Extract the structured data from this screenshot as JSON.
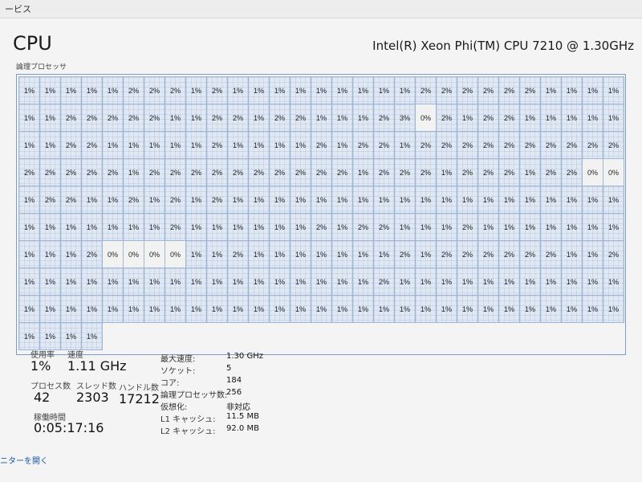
{
  "topbar": {
    "text": "ービス"
  },
  "header": {
    "title": "CPU",
    "cpu_model": "Intel(R) Xeon Phi(TM) CPU 7210 @ 1.30GHz",
    "grid_label": "論理プロセッサ"
  },
  "processors": [
    "1%",
    "1%",
    "1%",
    "1%",
    "1%",
    "2%",
    "2%",
    "2%",
    "1%",
    "2%",
    "1%",
    "1%",
    "1%",
    "1%",
    "1%",
    "1%",
    "1%",
    "1%",
    "1%",
    "2%",
    "2%",
    "2%",
    "2%",
    "2%",
    "2%",
    "1%",
    "1%",
    "1%",
    "1%",
    "1%",
    "1%",
    "2%",
    "2%",
    "2%",
    "2%",
    "2%",
    "1%",
    "1%",
    "2%",
    "2%",
    "1%",
    "2%",
    "2%",
    "1%",
    "1%",
    "1%",
    "2%",
    "3%",
    "0%",
    "2%",
    "1%",
    "2%",
    "2%",
    "1%",
    "1%",
    "1%",
    "1%",
    "1%",
    "1%",
    "1%",
    "2%",
    "2%",
    "1%",
    "1%",
    "1%",
    "1%",
    "1%",
    "2%",
    "1%",
    "1%",
    "1%",
    "1%",
    "2%",
    "1%",
    "2%",
    "2%",
    "1%",
    "2%",
    "2%",
    "2%",
    "2%",
    "2%",
    "2%",
    "2%",
    "2%",
    "2%",
    "2%",
    "2%",
    "2%",
    "2%",
    "2%",
    "2%",
    "1%",
    "2%",
    "2%",
    "2%",
    "2%",
    "2%",
    "2%",
    "2%",
    "2%",
    "2%",
    "2%",
    "1%",
    "2%",
    "2%",
    "2%",
    "1%",
    "2%",
    "2%",
    "2%",
    "1%",
    "2%",
    "2%",
    "0%",
    "0%",
    "1%",
    "2%",
    "2%",
    "1%",
    "1%",
    "2%",
    "1%",
    "2%",
    "1%",
    "2%",
    "1%",
    "1%",
    "1%",
    "1%",
    "1%",
    "1%",
    "1%",
    "1%",
    "1%",
    "1%",
    "1%",
    "1%",
    "1%",
    "1%",
    "1%",
    "1%",
    "1%",
    "1%",
    "1%",
    "1%",
    "1%",
    "1%",
    "1%",
    "1%",
    "1%",
    "1%",
    "2%",
    "1%",
    "1%",
    "1%",
    "1%",
    "1%",
    "1%",
    "2%",
    "1%",
    "2%",
    "2%",
    "1%",
    "1%",
    "1%",
    "2%",
    "1%",
    "1%",
    "1%",
    "1%",
    "1%",
    "1%",
    "1%",
    "1%",
    "1%",
    "1%",
    "2%",
    "0%",
    "0%",
    "0%",
    "0%",
    "1%",
    "1%",
    "2%",
    "1%",
    "1%",
    "1%",
    "1%",
    "1%",
    "1%",
    "1%",
    "2%",
    "1%",
    "2%",
    "2%",
    "2%",
    "2%",
    "2%",
    "2%",
    "1%",
    "1%",
    "2%",
    "1%",
    "1%",
    "1%",
    "1%",
    "1%",
    "1%",
    "1%",
    "1%",
    "1%",
    "1%",
    "1%",
    "1%",
    "1%",
    "1%",
    "1%",
    "1%",
    "1%",
    "2%",
    "1%",
    "1%",
    "1%",
    "1%",
    "1%",
    "1%",
    "1%",
    "1%",
    "1%",
    "1%",
    "1%",
    "1%",
    "1%",
    "1%",
    "1%",
    "1%",
    "1%",
    "1%",
    "1%",
    "1%",
    "1%",
    "1%",
    "1%",
    "1%",
    "1%",
    "1%",
    "1%",
    "1%",
    "1%",
    "1%",
    "1%",
    "1%",
    "1%",
    "1%",
    "1%",
    "1%",
    "1%",
    "1%",
    "1%",
    "1%",
    "1%",
    "1%",
    "1%",
    "1%"
  ],
  "stats": {
    "usage_label": "使用率",
    "usage_value": "1%",
    "speed_label": "速度",
    "speed_value": "1.11 GHz",
    "processes_label": "プロセス数",
    "processes_value": "42",
    "threads_label": "スレッド数",
    "threads_value": "2303",
    "handles_label": "ハンドル数",
    "handles_value": "17212",
    "uptime_label": "稼働時間",
    "uptime_value": "0:05:17:16"
  },
  "specs": [
    {
      "label": "最大速度:",
      "value": "1.30 GHz"
    },
    {
      "label": "ソケット:",
      "value": "5"
    },
    {
      "label": "コア:",
      "value": "184"
    },
    {
      "label": "論理プロセッサ数:",
      "value": "256"
    },
    {
      "label": "仮想化:",
      "value": "非対応"
    },
    {
      "label": "L1 キャッシュ:",
      "value": "11.5 MB"
    },
    {
      "label": "L2 キャッシュ:",
      "value": "92.0 MB"
    }
  ],
  "footer": {
    "link_text": "ニターを開く"
  }
}
